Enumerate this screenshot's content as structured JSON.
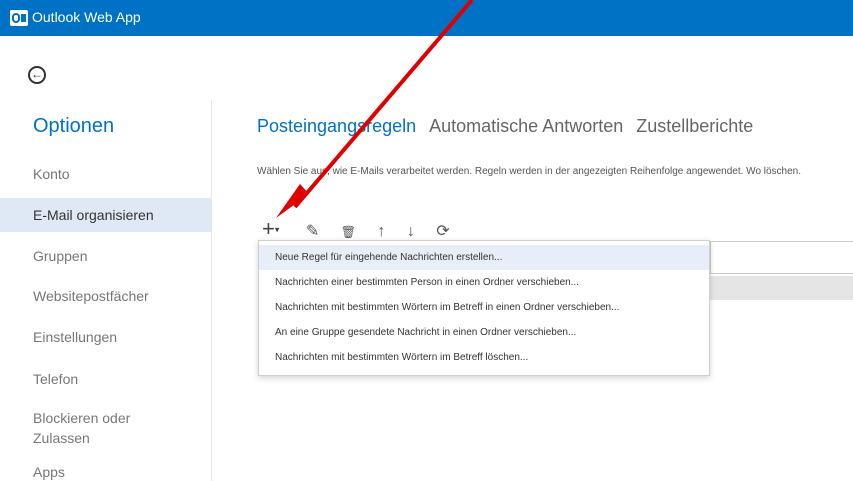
{
  "app": {
    "title": "Outlook Web App"
  },
  "sidebar": {
    "title": "Optionen",
    "items": [
      {
        "label": "Konto"
      },
      {
        "label": "E-Mail organisieren"
      },
      {
        "label": "Gruppen"
      },
      {
        "label": "Websitepostfächer"
      },
      {
        "label": "Einstellungen"
      },
      {
        "label": "Telefon"
      },
      {
        "label": "Blockieren oder Zulassen"
      },
      {
        "label": "Apps"
      }
    ]
  },
  "tabs": [
    {
      "label": "Posteingangsregeln"
    },
    {
      "label": "Automatische Antworten"
    },
    {
      "label": "Zustellberichte"
    }
  ],
  "description": "Wählen Sie aus, wie E-Mails verarbeitet werden. Regeln werden in der angezeigten Reihenfolge angewendet. Wo löschen.",
  "toolbar": {
    "add": "+",
    "edit": "✎",
    "delete": "🗑",
    "up": "↑",
    "down": "↓",
    "refresh": "⟳"
  },
  "menu": {
    "items": [
      {
        "label": "Neue Regel für eingehende Nachrichten erstellen..."
      },
      {
        "label": "Nachrichten einer bestimmten Person in einen Ordner verschieben..."
      },
      {
        "label": "Nachrichten mit bestimmten Wörtern im Betreff in einen Ordner verschieben..."
      },
      {
        "label": "An eine Gruppe gesendete Nachricht in einen Ordner verschieben..."
      },
      {
        "label": "Nachrichten mit bestimmten Wörtern im Betreff löschen..."
      }
    ]
  },
  "colors": {
    "brand": "#0072c6",
    "selected_bg": "#dfe9f5",
    "annotation_arrow": "#e00000"
  }
}
